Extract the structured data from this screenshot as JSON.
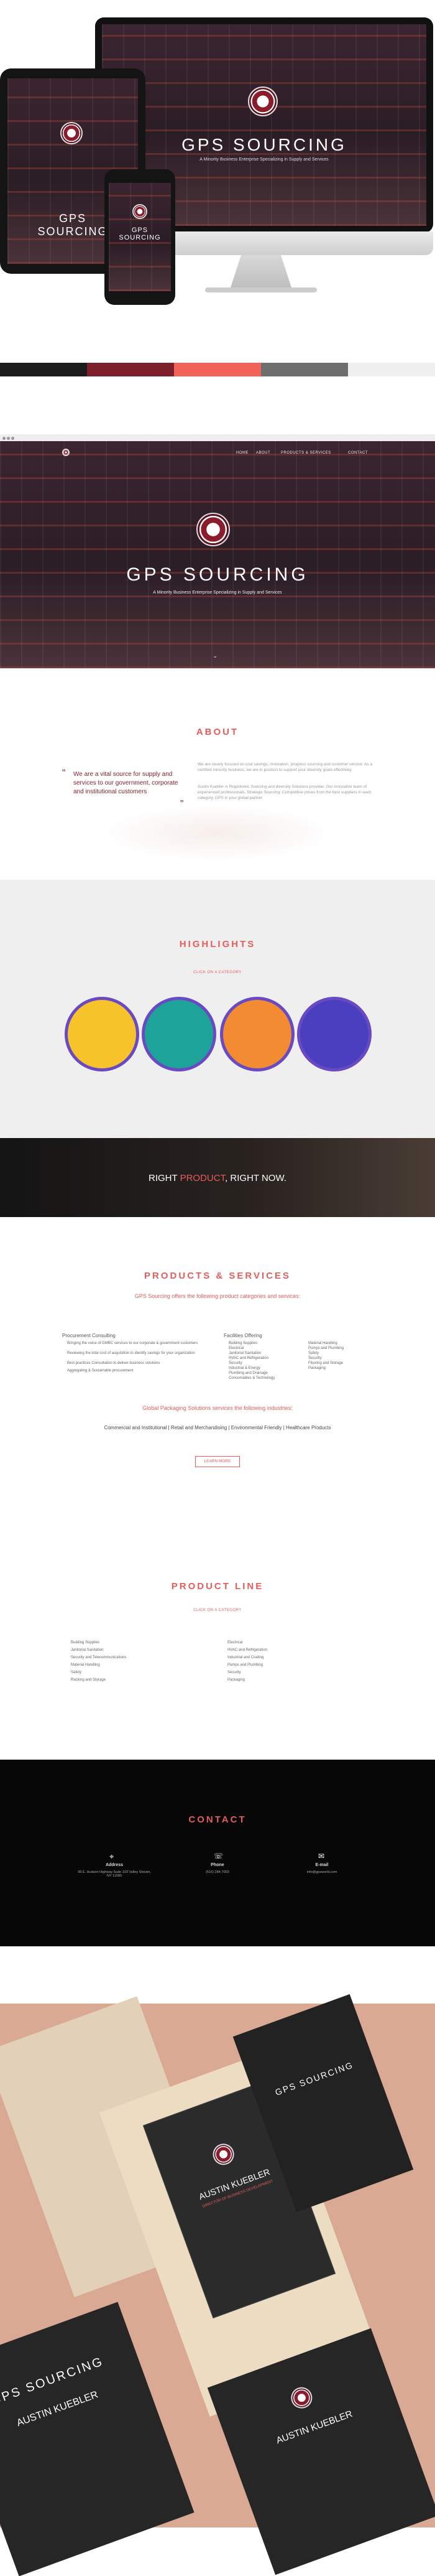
{
  "brand": {
    "name": "GPS SOURCING",
    "tagline": "A Minority Business Enterprise Specializing in Supply and Services"
  },
  "palette": [
    "#1c1c1c",
    "#7d1f2b",
    "#f2645a",
    "#6e6e6e",
    "#f0f0f0"
  ],
  "nav": [
    "HOME",
    "ABOUT",
    "PRODUCTS & SERVICES",
    "CONTACT"
  ],
  "about": {
    "title": "ABOUT",
    "quote": "We are a vital source for supply and services to our government, corporate and institutional customers",
    "p1": "We are clearly focused on cost savings, innovation, progress sourcing and customer service. As a certified minority business, we are in position to support your diversity goals effectively.",
    "p2": "Austin Kuebler is Registered, Sourcing and diversity Solutions provider. Our innovative team of experienced professionals. Strategic Sourcing: Competitive prices from the best suppliers in each category. GPS is your global partner."
  },
  "highlights": {
    "title": "HIGHLIGHTS",
    "sub": "CLICK ON A CATEGORY"
  },
  "banner": {
    "pre": "RIGHT ",
    "accent": "PRODUCT",
    "post": ", RIGHT NOW."
  },
  "products": {
    "title": "PRODUCTS & SERVICES",
    "intro": "GPS Sourcing offers the following product categories and services:",
    "col1_h": "Procurement Consulting",
    "col1": [
      "Bringing the voice of GMBC services to our corporate & government customers",
      "Reviewing the total cost of acquisition to identify savings for your organization",
      "Best practices Consultation to deliver business solutions",
      "Aggregating & Sustainable procurement"
    ],
    "col2_h": "Facilities Offering",
    "col2a": [
      "Building Supplies",
      "Electrical",
      "Janitorial Sanitation",
      "HVAC and Refrigeration",
      "Security",
      "Industrial & Energy",
      "Plumbing and Drainage",
      "Consumables & Technology"
    ],
    "col2b": [
      "Material Handling",
      "Pumps and Plumbing",
      "Safety",
      "Security",
      "Flooring and Storage",
      "Packaging"
    ],
    "pack_h": "Global Packaging Solutions services the following industries:",
    "pack_list": "Commercial and Institutional | Retail and Merchandising | Environmental Friendly | Healthcare Products",
    "button": "LEARN MORE"
  },
  "product_line": {
    "title": "PRODUCT LINE",
    "sub": "CLICK ON A CATEGORY",
    "left": [
      "Building Supplies",
      "Janitorial Sanitation",
      "Security and Telecommunications",
      "Material Handling",
      "Safety",
      "Racking and Storage"
    ],
    "right": [
      "Electrical",
      "HVAC and Refrigeration",
      "Industrial and Coating",
      "Pumps and Plumbing",
      "Security",
      "Packaging"
    ]
  },
  "contact": {
    "title": "CONTACT",
    "address_label": "Address",
    "address": "99 E. Hudson Highway Suite 103 Valley Stream, NY 11580",
    "phone_label": "Phone",
    "phone": "(516) 284-7003",
    "email_label": "E-mail",
    "email": "info@gpsworld.com"
  },
  "card": {
    "name": "AUSTIN KUEBLER",
    "title": "DIRECTOR OF BUSINESS DEVELOPMENT",
    "brand": "GPS SOURCING"
  }
}
